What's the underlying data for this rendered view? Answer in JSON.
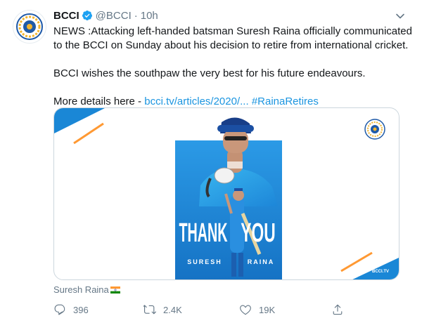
{
  "tweet": {
    "author_name": "BCCI",
    "handle": "@BCCI",
    "separator": "·",
    "time": "10h",
    "text_p1": "NEWS :Attacking left-handed batsman Suresh Raina officially communicated to the BCCI on Sunday about his decision to retire from international cricket.",
    "text_p2": "BCCI wishes the southpaw the very best for his future endeavours.",
    "text_p3_prefix": "More details here - ",
    "link_url": "bcci.tv/articles/2020/...",
    "hashtag": "#RainaRetires"
  },
  "card": {
    "thank": "THANK",
    "you": "YOU",
    "first_name": "SURESH",
    "last_name": "RAINA",
    "brand": "BCCI.TV"
  },
  "media_tag": {
    "label": "Suresh Raina"
  },
  "actions": {
    "replies": "396",
    "retweets": "2.4K",
    "likes": "19K"
  },
  "colors": {
    "brand_blue": "#1da1f2",
    "link_blue": "#1b95e0",
    "card_blue": "#1a87d6",
    "orange": "#ff9933",
    "muted": "#657786"
  },
  "icons": [
    "bcci-logo-icon",
    "verified-badge-icon",
    "chevron-down-icon",
    "reply-icon",
    "retweet-icon",
    "like-icon",
    "share-icon",
    "india-flag-icon"
  ]
}
